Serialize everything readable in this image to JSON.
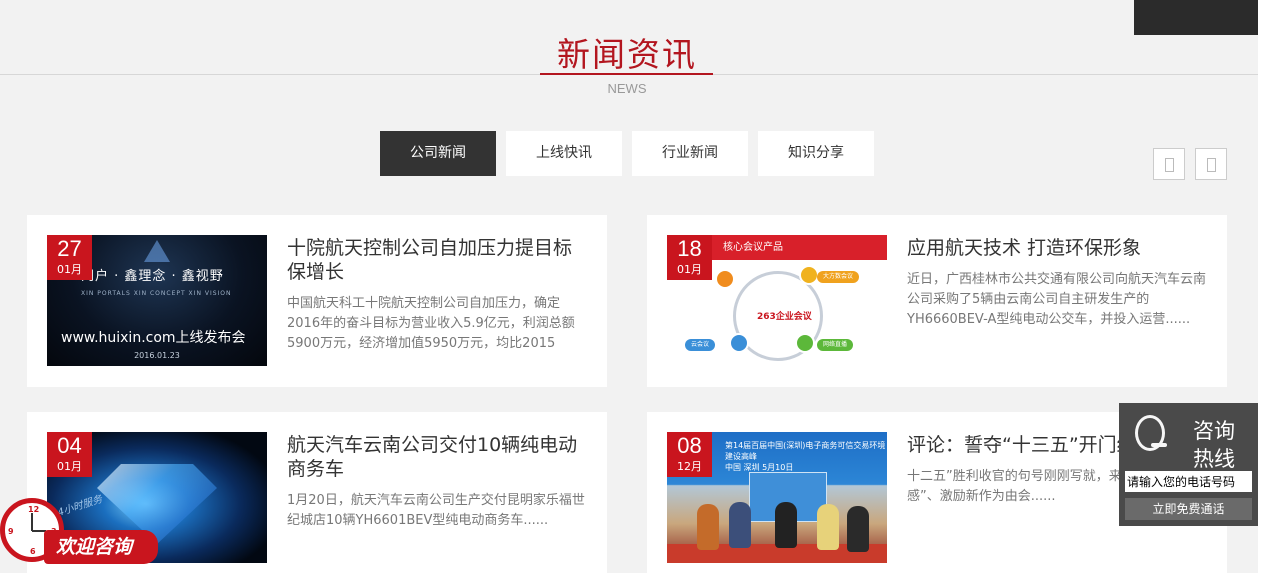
{
  "section": {
    "title": "新闻资讯",
    "subtitle": "NEWS"
  },
  "tabs": [
    {
      "label": "公司新闻",
      "active": true
    },
    {
      "label": "上线快讯",
      "active": false
    },
    {
      "label": "行业新闻",
      "active": false
    },
    {
      "label": "知识分享",
      "active": false
    }
  ],
  "colors": {
    "accent": "#b3161f",
    "date_badge": "#c9151e",
    "tab_active": "#333333",
    "background": "#f2f2f2"
  },
  "news": [
    {
      "day": "27",
      "month": "01月",
      "title": "十院航天控制公司自加压力提目标保增长",
      "desc": "中国航天科工十院航天控制公司自加压力，确定2016年的奋斗目标为营业收入5.9亿元，利润总额5900万元，经济增加值5950万元，均比2015",
      "thumb": {
        "line1": "门户 · 鑫理念 · 鑫视野",
        "line2": "XIN PORTALS    XIN CONCEPT    XIN VISION",
        "line3": "www.huixin.com上线发布会",
        "line4": "2016.01.23"
      }
    },
    {
      "day": "18",
      "month": "01月",
      "title": "应用航天技术 打造环保形象",
      "desc": "近日，广西桂林市公共交通有限公司向航天汽车云南公司采购了5辆由云南公司自主研发生产的YH6660BEV-A型纯电动公交车，并投入运营......",
      "thumb": {
        "bar": "核心会议产品",
        "logo": "263企业会议",
        "pills": [
          "大方数会议",
          "网络直播",
          "云会议"
        ]
      }
    },
    {
      "day": "04",
      "month": "01月",
      "title": "航天汽车云南公司交付10辆纯电动商务车",
      "desc": "1月20日，航天汽车云南公司生产交付昆明家乐福世纪城店10辆YH6601BEV型纯电动商务车......"
    },
    {
      "day": "08",
      "month": "12月",
      "title": "评论：誓夺“十三五”开门红",
      "desc": "十二五”胜利收官的句号刚刚写就，来、盘点“获得感”、激励新作为由会......",
      "thumb": {
        "banner": "第14届百届中国(深圳)电子商务可信交易环境建设高峰",
        "sub": "中国 深圳  5月10日"
      }
    }
  ],
  "float_consult": {
    "label": "欢迎咨询",
    "badge": "24小时服务"
  },
  "hotline": {
    "title1": "咨询",
    "title2": "热线",
    "phone_placeholder": "请输入您的电话号码",
    "call_label": "立即免费通话"
  }
}
